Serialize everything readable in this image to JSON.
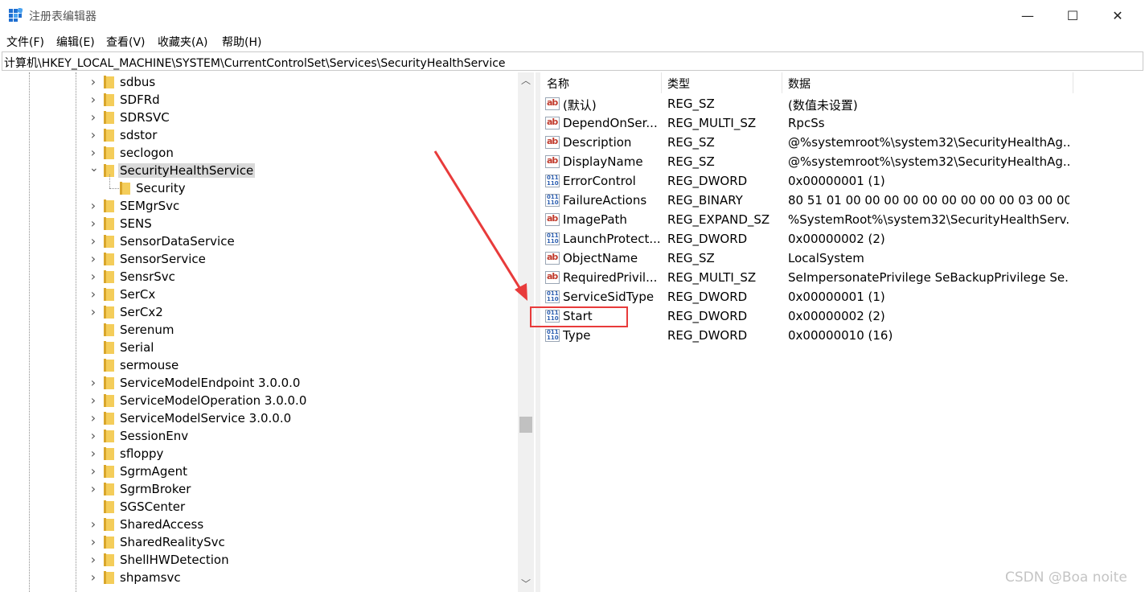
{
  "window": {
    "title": "注册表编辑器",
    "minimize_glyph": "—",
    "maximize_glyph": "☐",
    "close_glyph": "✕"
  },
  "menu": [
    "文件(F)",
    "编辑(E)",
    "查看(V)",
    "收藏夹(A)",
    "帮助(H)"
  ],
  "address": "计算机\\HKEY_LOCAL_MACHINE\\SYSTEM\\CurrentControlSet\\Services\\SecurityHealthService",
  "tree": [
    {
      "label": "sdbus",
      "expandable": true
    },
    {
      "label": "SDFRd",
      "expandable": true
    },
    {
      "label": "SDRSVC",
      "expandable": true
    },
    {
      "label": "sdstor",
      "expandable": true
    },
    {
      "label": "seclogon",
      "expandable": true
    },
    {
      "label": "SecurityHealthService",
      "expandable": true,
      "expanded": true,
      "selected": true
    },
    {
      "label": "Security",
      "expandable": false,
      "child": true
    },
    {
      "label": "SEMgrSvc",
      "expandable": true
    },
    {
      "label": "SENS",
      "expandable": true
    },
    {
      "label": "SensorDataService",
      "expandable": true
    },
    {
      "label": "SensorService",
      "expandable": true
    },
    {
      "label": "SensrSvc",
      "expandable": true
    },
    {
      "label": "SerCx",
      "expandable": true
    },
    {
      "label": "SerCx2",
      "expandable": true
    },
    {
      "label": "Serenum",
      "expandable": false
    },
    {
      "label": "Serial",
      "expandable": false
    },
    {
      "label": "sermouse",
      "expandable": false
    },
    {
      "label": "ServiceModelEndpoint 3.0.0.0",
      "expandable": true
    },
    {
      "label": "ServiceModelOperation 3.0.0.0",
      "expandable": true
    },
    {
      "label": "ServiceModelService 3.0.0.0",
      "expandable": true
    },
    {
      "label": "SessionEnv",
      "expandable": true
    },
    {
      "label": "sfloppy",
      "expandable": true
    },
    {
      "label": "SgrmAgent",
      "expandable": true
    },
    {
      "label": "SgrmBroker",
      "expandable": true
    },
    {
      "label": "SGSCenter",
      "expandable": false
    },
    {
      "label": "SharedAccess",
      "expandable": true
    },
    {
      "label": "SharedRealitySvc",
      "expandable": true
    },
    {
      "label": "ShellHWDetection",
      "expandable": true
    },
    {
      "label": "shpamsvc",
      "expandable": true
    }
  ],
  "columns": {
    "name": "名称",
    "type": "类型",
    "data": "数据"
  },
  "values": [
    {
      "name": "(默认)",
      "type": "REG_SZ",
      "data": "(数值未设置)",
      "icon": "string-value-icon"
    },
    {
      "name": "DependOnSer...",
      "type": "REG_MULTI_SZ",
      "data": "RpcSs",
      "icon": "string-value-icon"
    },
    {
      "name": "Description",
      "type": "REG_SZ",
      "data": "@%systemroot%\\system32\\SecurityHealthAg...",
      "icon": "string-value-icon"
    },
    {
      "name": "DisplayName",
      "type": "REG_SZ",
      "data": "@%systemroot%\\system32\\SecurityHealthAg...",
      "icon": "string-value-icon"
    },
    {
      "name": "ErrorControl",
      "type": "REG_DWORD",
      "data": "0x00000001 (1)",
      "icon": "binary-value-icon"
    },
    {
      "name": "FailureActions",
      "type": "REG_BINARY",
      "data": "80 51 01 00 00 00 00 00 00 00 00 00 03 00 00 ...",
      "icon": "binary-value-icon"
    },
    {
      "name": "ImagePath",
      "type": "REG_EXPAND_SZ",
      "data": "%SystemRoot%\\system32\\SecurityHealthServ...",
      "icon": "string-value-icon"
    },
    {
      "name": "LaunchProtect...",
      "type": "REG_DWORD",
      "data": "0x00000002 (2)",
      "icon": "binary-value-icon"
    },
    {
      "name": "ObjectName",
      "type": "REG_SZ",
      "data": "LocalSystem",
      "icon": "string-value-icon"
    },
    {
      "name": "RequiredPrivil...",
      "type": "REG_MULTI_SZ",
      "data": "SeImpersonatePrivilege SeBackupPrivilege Se...",
      "icon": "string-value-icon"
    },
    {
      "name": "ServiceSidType",
      "type": "REG_DWORD",
      "data": "0x00000001 (1)",
      "icon": "binary-value-icon"
    },
    {
      "name": "Start",
      "type": "REG_DWORD",
      "data": "0x00000002 (2)",
      "icon": "binary-value-icon"
    },
    {
      "name": "Type",
      "type": "REG_DWORD",
      "data": "0x00000010 (16)",
      "icon": "binary-value-icon"
    }
  ],
  "icon_glyphs": {
    "string": "ab",
    "binary": "011 110"
  },
  "scroll": {
    "up": "︿",
    "down": "﹀"
  },
  "watermark": "CSDN @Boa noite",
  "colors": {
    "annotation": "#e83b3b",
    "folder": "#f4cd5a",
    "selection": "#d9d9d9"
  }
}
